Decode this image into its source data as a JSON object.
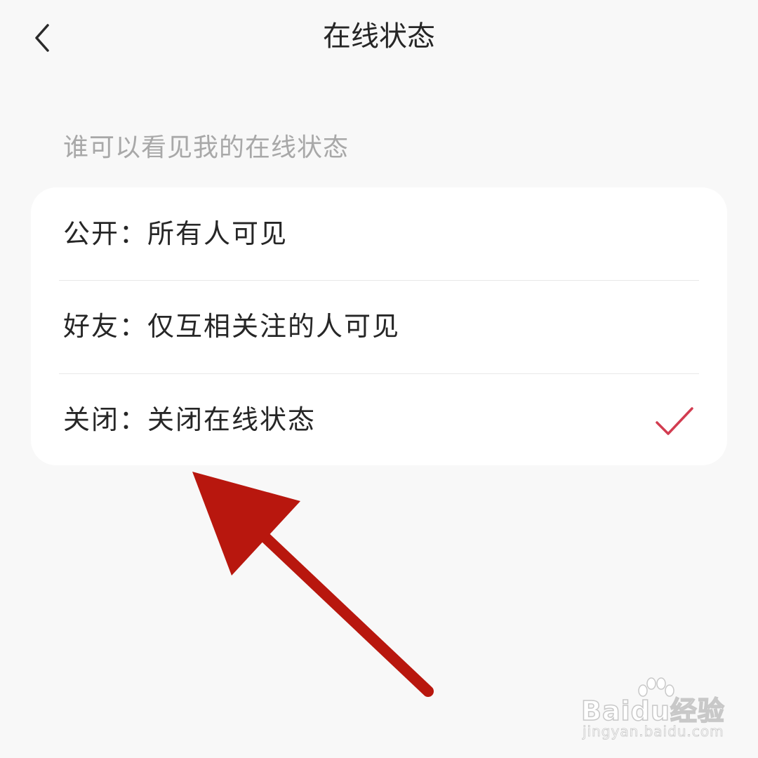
{
  "header": {
    "title": "在线状态",
    "back_icon": "chevron-left-icon"
  },
  "section": {
    "label": "谁可以看见我的在线状态"
  },
  "options": [
    {
      "label": "公开：所有人可见",
      "selected": false
    },
    {
      "label": "好友：仅互相关注的人可见",
      "selected": false
    },
    {
      "label": "关闭：关闭在线状态",
      "selected": true
    }
  ],
  "colors": {
    "background": "#f8f8f8",
    "card": "#ffffff",
    "check": "#d23c50",
    "annotation_arrow": "#b8170e"
  },
  "watermark": {
    "brand": "Baidu经验",
    "url": "jingyan.baidu.com"
  }
}
